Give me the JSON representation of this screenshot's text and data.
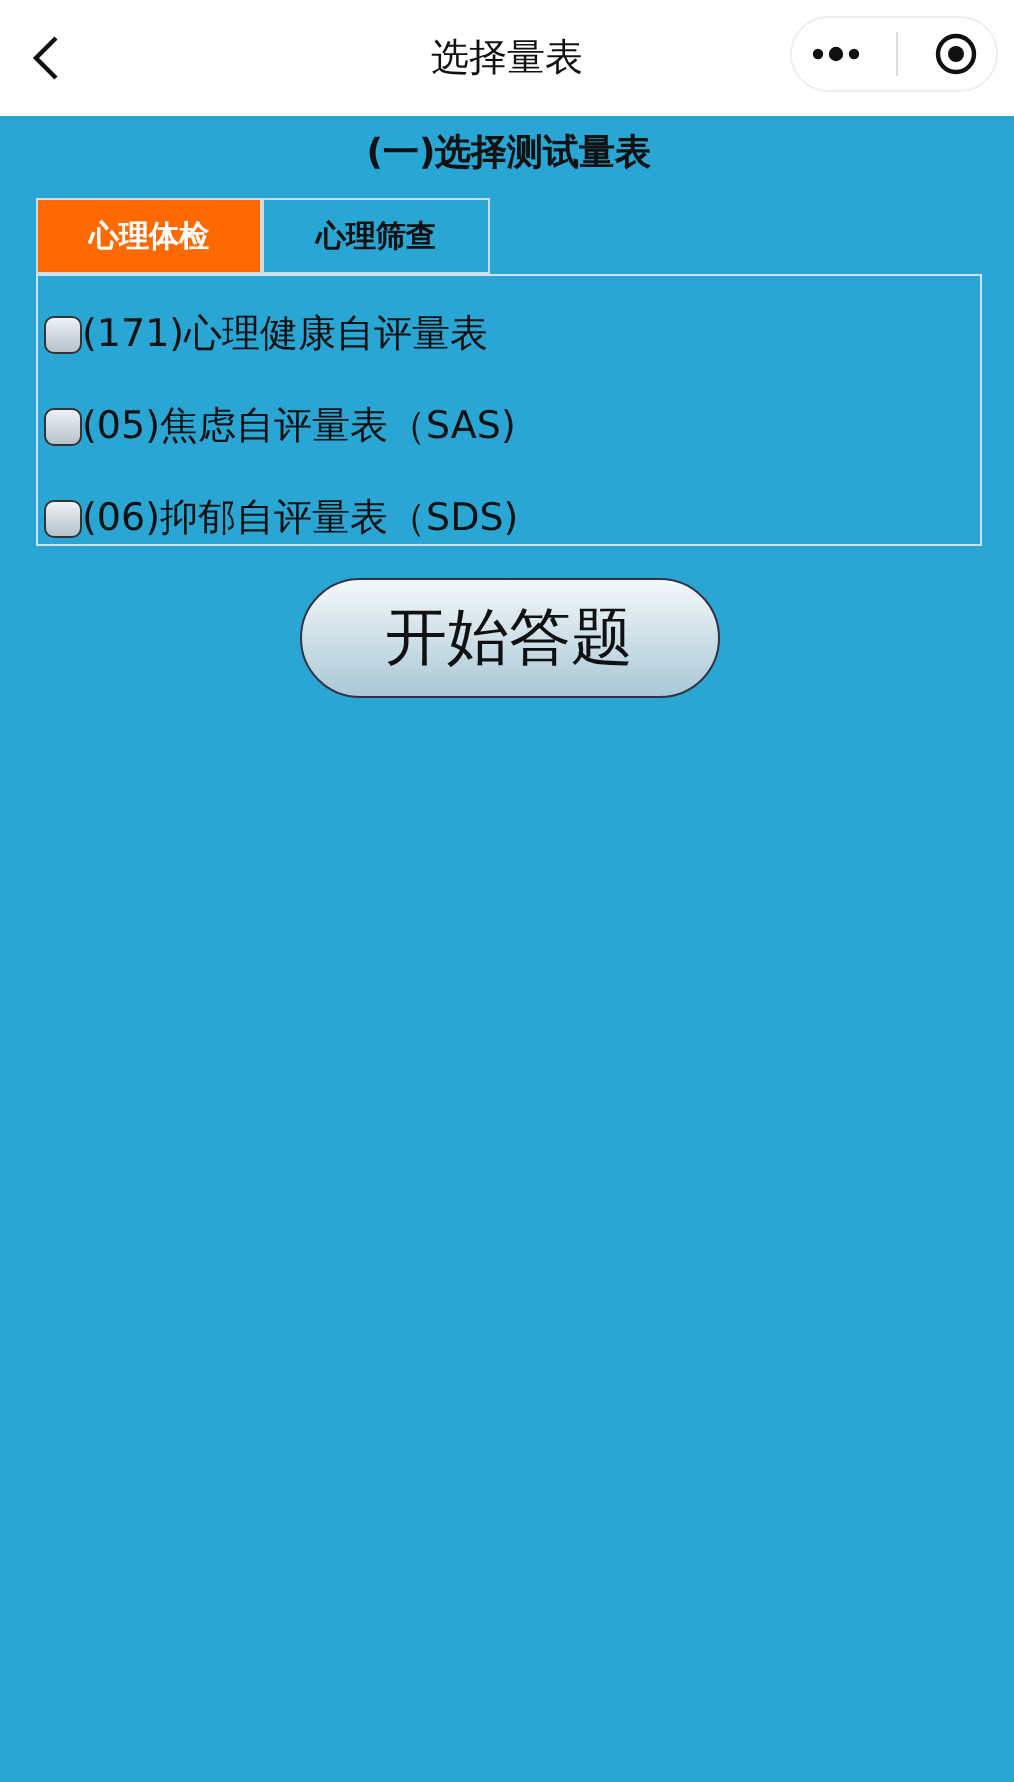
{
  "nav_bar": {
    "title": "选择量表"
  },
  "section_title": "(一)选择测试量表",
  "tabs": [
    {
      "label": "心理体检",
      "selected": true
    },
    {
      "label": "心理筛查",
      "selected": false
    }
  ],
  "scales": [
    {
      "label": "(171)心理健康自评量表",
      "checked": false
    },
    {
      "label": "(05)焦虑自评量表（SAS)",
      "checked": false
    },
    {
      "label": "(06)抑郁自评量表（SDS)",
      "checked": false
    }
  ],
  "start_button": "开始答题"
}
